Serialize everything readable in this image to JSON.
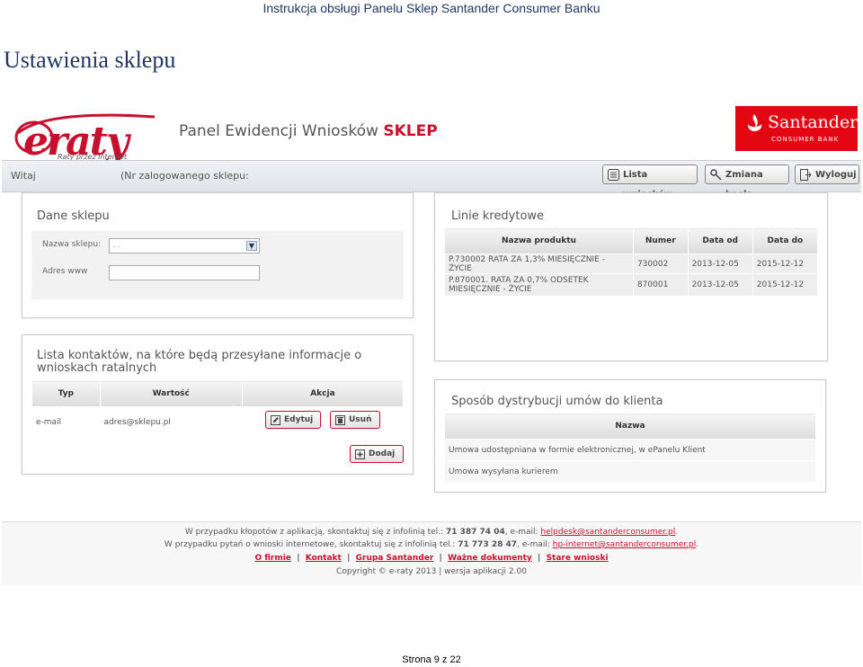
{
  "doc": {
    "header": "Instrukcja obsługi Panelu Sklep Santander Consumer Banku",
    "title": "Ustawienia sklepu",
    "page": "Strona 9 z 22"
  },
  "app": {
    "logo_text": "eraty",
    "logo_tagline": "Raty przez Internet",
    "panel_title": "Panel Ewidencji Wniosków",
    "panel_title_accent": "SKLEP",
    "bank_name": "Santander",
    "bank_sub": "CONSUMER BANK",
    "colors": {
      "accent": "#c8102e",
      "bank": "#e30613"
    }
  },
  "topbar": {
    "welcome": "Witaj",
    "logged_shop": "(Nr zalogowanego sklepu:",
    "buttons": [
      "Lista wniosków",
      "Zmiana hasła",
      "Wyloguj"
    ]
  },
  "shop": {
    "title": "Dane sklepu",
    "name_label": "Nazwa sklepu:",
    "url_label": "Adres www",
    "name_value": ".   .",
    "url_value": ""
  },
  "credit": {
    "title": "Linie kredytowe",
    "headers": [
      "Nazwa produktu",
      "Numer",
      "Data od",
      "Data do"
    ],
    "rows": [
      [
        "P.730002 RATA ZA 1,3% MIESIĘCZNIE - ŻYCIE",
        "730002",
        "2013-12-05",
        "2015-12-12"
      ],
      [
        "P.870001. RATA ZA 0,7% ODSETEK MIESIĘCZNIE - ŻYCIE",
        "870001",
        "2013-12-05",
        "2015-12-12"
      ]
    ]
  },
  "contacts": {
    "title": "Lista kontaktów, na które będą przesyłane informacje o wnioskach ratalnych",
    "headers": [
      "Typ",
      "Wartość",
      "Akcja"
    ],
    "row": {
      "type": "e-mail",
      "value": "adres@sklepu.pl",
      "edit": "Edytuj",
      "delete": "Usuń"
    },
    "add": "Dodaj"
  },
  "distribution": {
    "title": "Sposób dystrybucji umów do klienta",
    "header": "Nazwa",
    "rows": [
      "Umowa udostępniana w formie elektronicznej, w ePanelu Klient",
      "Umowa wysyłana kurierem"
    ]
  },
  "footer": {
    "line1_text": "W przypadku kłopotów z aplikacją, skontaktuj się z infolinią tel.:",
    "line1_phone": "71 387 74 04",
    "line1_mid": ", e-mail:",
    "line1_email": "helpdesk@santanderconsumer.pl",
    "line2_text": "W przypadku pytań o wnioski internetowe, skontaktuj się z infolinią tel.:",
    "line2_phone": "71 773 28 47",
    "line2_mid": ", e-mail:",
    "line2_email": "hp-internet@santanderconsumer.pl",
    "nav": [
      "O firmie",
      "Kontakt",
      "Grupa Santander",
      "Ważne dokumenty",
      "Stare wnioski"
    ],
    "copyright": "Copyright © e-raty 2013 | wersja aplikacji 2.00"
  }
}
